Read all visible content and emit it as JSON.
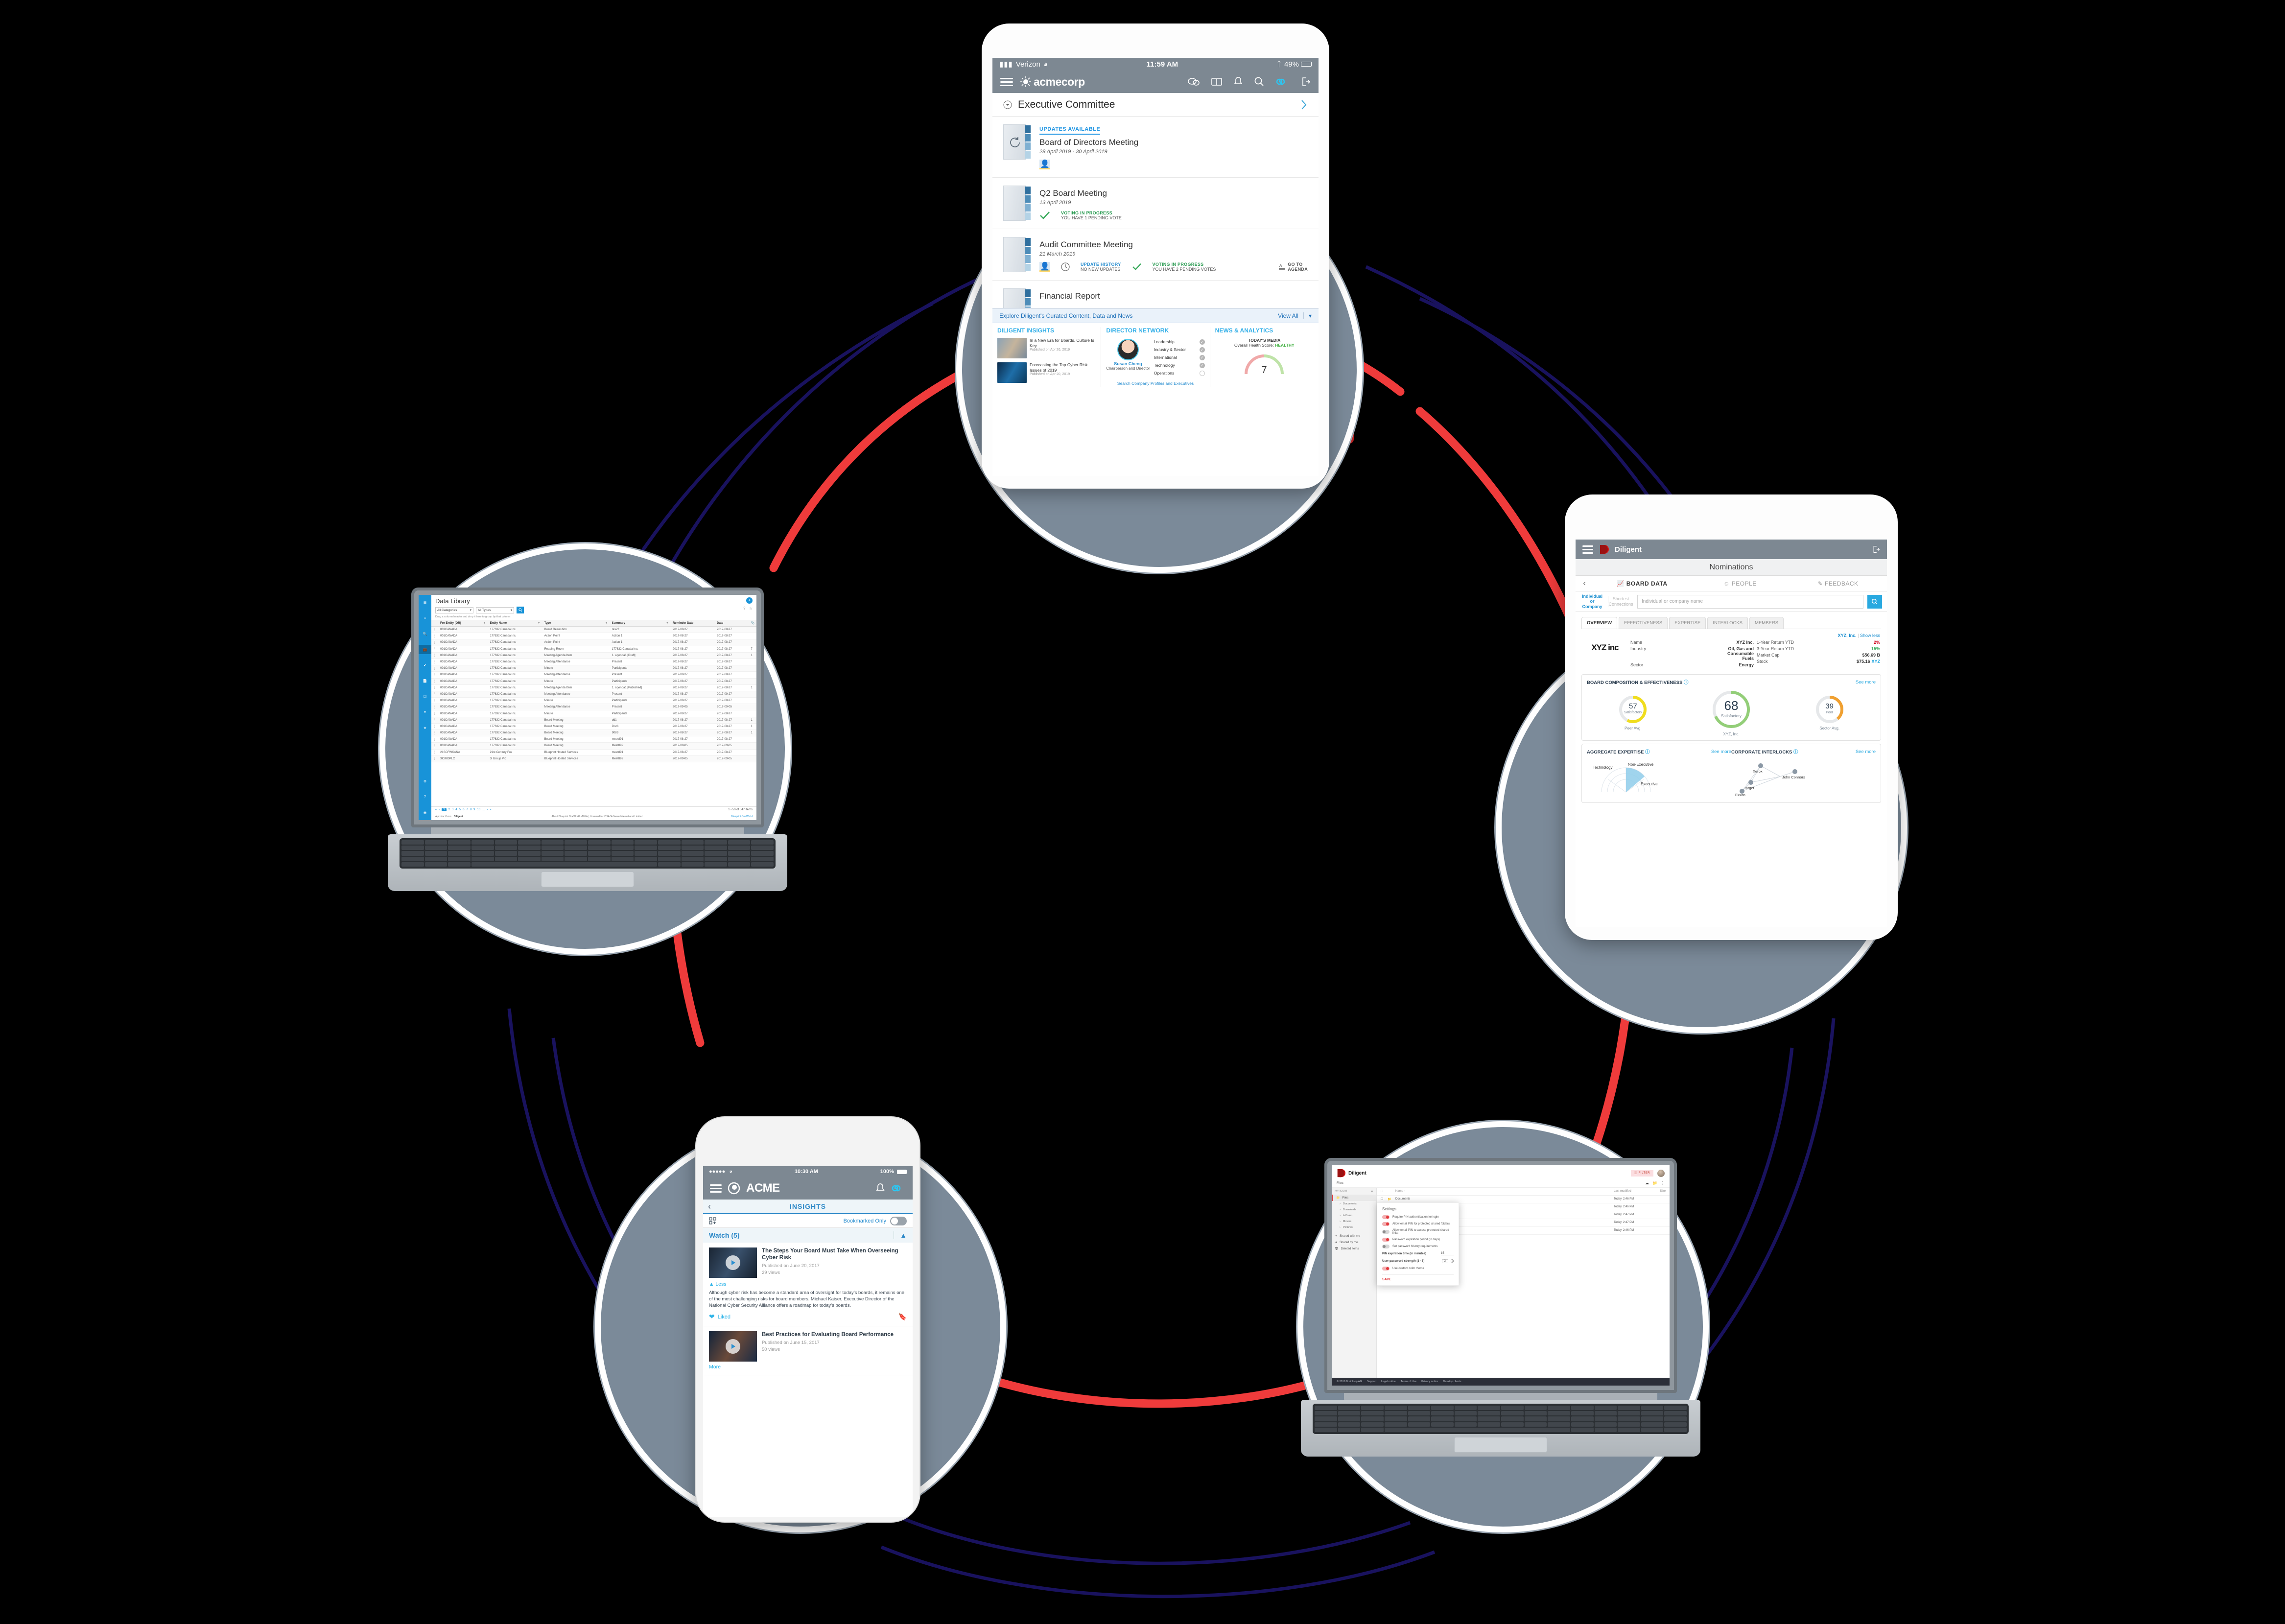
{
  "scene": {
    "background": "#000000",
    "ring_color": "#ef3b3b",
    "arc_color": "#1b1464",
    "plate_color": "#7b8a99",
    "lock_icon": "padlock-icon"
  },
  "tablet_acme": {
    "status": {
      "carrier": "Verizon",
      "wifi": "wifi-icon",
      "time": "11:59 AM",
      "bluetooth": "bluetooth-icon",
      "battery": "49%"
    },
    "nav": {
      "menu": "hamburger-icon",
      "brand": "acmecorp",
      "icons": [
        "chat-icon",
        "book-icon",
        "bell-icon",
        "search-icon",
        "infinity-icon",
        "logout-icon"
      ]
    },
    "section": {
      "label": "Executive Committee",
      "chevron": "chevron-right-icon"
    },
    "items": [
      {
        "badge": "UPDATES AVAILABLE",
        "title": "Board of Directors Meeting",
        "date": "28 April 2019 - 30 April 2019",
        "meta": [
          {
            "icon": "people-icon",
            "line1": "",
            "line2": ""
          }
        ]
      },
      {
        "badge": "",
        "title": "Q2 Board Meeting",
        "date": "13 April 2019",
        "meta": [
          {
            "icon": "check-icon",
            "line1": "VOTING IN PROGRESS",
            "line2": "YOU HAVE 1 PENDING VOTE"
          }
        ]
      },
      {
        "badge": "",
        "title": "Audit Committee Meeting",
        "date": "21 March 2019",
        "meta": [
          {
            "icon": "people-icon",
            "line1": "",
            "line2": ""
          },
          {
            "icon": "clock-icon",
            "line1": "UPDATE HISTORY",
            "line2": "NO NEW UPDATES"
          },
          {
            "icon": "check-icon",
            "line1": "VOTING IN PROGRESS",
            "line2": "YOU HAVE 2 PENDING VOTES"
          },
          {
            "icon": "agenda-icon",
            "line1": "GO TO",
            "line2": "AGENDA"
          }
        ]
      },
      {
        "badge": "",
        "title": "Financial Report",
        "date": "",
        "meta": []
      }
    ],
    "explore": {
      "label": "Explore Diligent's Curated Content, Data and News",
      "view_all": "View All",
      "chevron": "chevron-down-icon"
    },
    "insights": {
      "heading": "DILIGENT INSIGHTS",
      "articles": [
        {
          "title": "In a New Era for Boards, Culture Is Key",
          "published": "Published on Apr 26, 2019"
        },
        {
          "title": "Forecasting the Top Cyber Risk Issues of 2019",
          "published": "Published on Apr 20, 2019"
        }
      ]
    },
    "director_network": {
      "heading": "DIRECTOR NETWORK",
      "person": {
        "name": "Susan Cheng",
        "role": "Chairperson and Director"
      },
      "skills": [
        {
          "label": "Leadership",
          "checked": true
        },
        {
          "label": "Industry & Sector",
          "checked": true
        },
        {
          "label": "International",
          "checked": true
        },
        {
          "label": "Technology",
          "checked": true
        },
        {
          "label": "Operations",
          "checked": false
        }
      ],
      "link": "Search Company Profiles and Executives"
    },
    "news_analytics": {
      "heading": "NEWS & ANALYTICS",
      "subheading": "TODAY'S MEDIA",
      "score_label": "Overall Health Score:",
      "score_value": "HEALTHY",
      "gauge_number": "7"
    }
  },
  "tablet_diligent": {
    "nav": {
      "menu": "hamburger-icon",
      "brand": "Diligent",
      "logout": "logout-icon"
    },
    "page_title": "Nominations",
    "back": "chevron-left-icon",
    "tabs": [
      {
        "label": "BOARD DATA",
        "icon": "chart-icon",
        "active": true
      },
      {
        "label": "PEOPLE",
        "icon": "person-icon",
        "active": false
      },
      {
        "label": "FEEDBACK",
        "icon": "feedback-icon",
        "active": false
      }
    ],
    "search": {
      "segments": [
        {
          "label": "Individual or Company",
          "active": true
        },
        {
          "label": "Shortest Connections",
          "active": false
        }
      ],
      "placeholder": "Individual or company name",
      "button": "search-icon"
    },
    "subtabs": [
      {
        "label": "OVERVIEW",
        "active": true
      },
      {
        "label": "EFFECTIVENESS",
        "active": false
      },
      {
        "label": "EXPERTISE",
        "active": false
      },
      {
        "label": "INTERLOCKS",
        "active": false
      },
      {
        "label": "MEMBERS",
        "active": false
      }
    ],
    "company": {
      "chip": "XYZ, Inc.",
      "show_less": "Show less",
      "logo_text": "XYZ inc",
      "facts_left": [
        {
          "label": "Name",
          "value": "XYZ Inc."
        },
        {
          "label": "Industry",
          "value": "Oil, Gas and Consumable Fuels"
        },
        {
          "label": "Sector",
          "value": "Energy"
        }
      ],
      "facts_right": [
        {
          "label": "1-Year Return YTD",
          "value": "2%",
          "trend": "down"
        },
        {
          "label": "3-Year Return YTD",
          "value": "15%",
          "trend": "up"
        },
        {
          "label": "Market Cap",
          "value": "$56.69 B",
          "trend": ""
        },
        {
          "label": "Stock",
          "value": "$75.16",
          "ticker": "XYZ",
          "trend": ""
        }
      ]
    },
    "composition": {
      "heading": "BOARD COMPOSITION & EFFECTIVENESS",
      "info": "info-icon",
      "see_more": "See more",
      "center_caption": "XYZ, Inc.",
      "gauges": [
        {
          "value": "57",
          "rating": "Satisfactory",
          "caption": "Peer Avg.",
          "color": "#f0dd1e",
          "pct": 57
        },
        {
          "value": "68",
          "rating": "Satisfactory",
          "caption": "",
          "color": "#93ce78",
          "pct": 68
        },
        {
          "value": "39",
          "rating": "Poor",
          "caption": "Sector Avg.",
          "color": "#f0a030",
          "pct": 39
        }
      ]
    },
    "expertise": {
      "heading": "AGGREGATE EXPERTISE",
      "info": "info-icon",
      "see_more": "See more",
      "labels": [
        "Technology",
        "Non-Executive",
        "Executive"
      ]
    },
    "interlocks": {
      "heading": "CORPORATE INTERLOCKS",
      "info": "info-icon",
      "see_more": "See more",
      "nodes": [
        "Xerox",
        "John Connors",
        "Target",
        "Exxon"
      ]
    }
  },
  "phone_acme": {
    "status": {
      "signal": "signal-dots-icon",
      "wifi": "wifi-icon",
      "time": "10:30 AM",
      "battery": "100%"
    },
    "nav": {
      "menu": "hamburger-icon",
      "brand": "ACME",
      "bell": "bell-icon",
      "infinity": "infinity-icon"
    },
    "subnav": {
      "back": "chevron-left-icon",
      "title": "INSIGHTS"
    },
    "filter": {
      "grid_icon": "add-grid-icon",
      "toggle_label": "Bookmarked Only",
      "toggle_on": false
    },
    "section": {
      "label": "Watch (5)",
      "chevron": "chevron-up-icon"
    },
    "cards": [
      {
        "title": "The Steps Your Board Must Take When Overseeing Cyber Risk",
        "published": "Published on June 20, 2017",
        "views": "29 views",
        "expand": "Less",
        "body": "Although cyber risk has become a standard area of oversight for today’s boards, it remains one of the most challenging risks for board members. Michael Kaiser, Executive Director of the National Cyber Security Alliance offers a roadmap for today’s boards.",
        "like": "Liked",
        "bookmark": "bookmark-icon"
      },
      {
        "title": "Best Practices for Evaluating Board Performance",
        "published": "Published on June 15, 2017",
        "views": "50 views",
        "expand": "More",
        "body": "",
        "like": "",
        "bookmark": ""
      }
    ]
  },
  "laptop_datalibrary": {
    "sidebar_icons": [
      "hamburger-icon",
      "home-icon",
      "search-icon",
      "briefcase-icon",
      "check-icon",
      "document-icon",
      "tasks-icon",
      "clock-icon",
      "star-icon",
      "gear-icon",
      "help-icon",
      "user-icon"
    ],
    "title": "Data Library",
    "filters": [
      {
        "label": "All Categories"
      },
      {
        "label": "All Types"
      }
    ],
    "search_button": "search-icon",
    "actions": [
      "add-icon",
      "share-icon",
      "star-icon"
    ],
    "group_hint": "Drag a column header and drop it here to group by that column",
    "columns": [
      "For Entity (OR)",
      "Entity Name",
      "Type",
      "Summary",
      "Reminder Date",
      "Date",
      "attachment-icon"
    ],
    "rows": [
      [
        "001CANADA",
        "177632 Canada Inc.",
        "Board Resolution",
        "res22",
        "2017-08-27",
        "2017-08-27",
        ""
      ],
      [
        "001CANADA",
        "177632 Canada Inc.",
        "Action Point",
        "Action 1",
        "2017-08-27",
        "2017-08-27",
        ""
      ],
      [
        "001CANADA",
        "177632 Canada Inc.",
        "Action Point",
        "Action 1",
        "2017-08-27",
        "2017-08-27",
        ""
      ],
      [
        "001CANADA",
        "177632 Canada Inc.",
        "Reading Room",
        "177632 Canada Inc.",
        "2017-08-27",
        "2017-08-27",
        "7"
      ],
      [
        "001CANADA",
        "177632 Canada Inc.",
        "Meeting Agenda Item",
        "1. agenda1 [Draft]",
        "2017-08-27",
        "2017-08-27",
        "1"
      ],
      [
        "001CANADA",
        "177632 Canada Inc.",
        "Meeting Attendance",
        "Present",
        "2017-08-27",
        "2017-08-27",
        ""
      ],
      [
        "001CANADA",
        "177632 Canada Inc.",
        "Minute",
        "Participants",
        "2017-08-27",
        "2017-08-27",
        ""
      ],
      [
        "001CANADA",
        "177632 Canada Inc.",
        "Meeting Attendance",
        "Present",
        "2017-08-27",
        "2017-08-27",
        ""
      ],
      [
        "001CANADA",
        "177632 Canada Inc.",
        "Minute",
        "Participants",
        "2017-08-27",
        "2017-08-27",
        ""
      ],
      [
        "001CANADA",
        "177632 Canada Inc.",
        "Meeting Agenda Item",
        "1. agenda1 [Published]",
        "2017-08-27",
        "2017-08-27",
        "1"
      ],
      [
        "001CANADA",
        "177632 Canada Inc.",
        "Meeting Attendance",
        "Present",
        "2017-08-27",
        "2017-09-27",
        ""
      ],
      [
        "001CANADA",
        "177632 Canada Inc.",
        "Minute",
        "Participants",
        "2017-08-27",
        "2017-08-27",
        ""
      ],
      [
        "001CANADA",
        "177632 Canada Inc.",
        "Meeting Attendance",
        "Present",
        "2017-09-05",
        "2017-09-05",
        ""
      ],
      [
        "001CANADA",
        "177632 Canada Inc.",
        "Minute",
        "Participants",
        "2017-08-27",
        "2017-08-27",
        ""
      ],
      [
        "001CANADA",
        "177632 Canada Inc.",
        "Board Meeting",
        "dd1",
        "2017-08-27",
        "2017-08-27",
        "1"
      ],
      [
        "001CANADA",
        "177632 Canada Inc.",
        "Board Meeting",
        "Doc1",
        "2017-08-27",
        "2017-08-27",
        "1"
      ],
      [
        "001CANADA",
        "177632 Canada Inc.",
        "Board Meeting",
        "9089",
        "2017-08-27",
        "2017-08-27",
        "1"
      ],
      [
        "001CANADA",
        "177632 Canada Inc.",
        "Board Meeting",
        "meet891",
        "2017-08-27",
        "2017-08-27",
        ""
      ],
      [
        "001CANADA",
        "177632 Canada Inc.",
        "Board Meeting",
        "Meet892",
        "2017-09-05",
        "2017-09-05",
        ""
      ],
      [
        "21SCFWKANA",
        "21st Century Fox",
        "Blueprint Hosted Services",
        "meet891",
        "2017-08-27",
        "2017-08-27",
        ""
      ],
      [
        "3IGROPLC",
        "3i Group Plc",
        "Blueprint Hosted Services",
        "Meet892",
        "2017-09-05",
        "2017-09-05",
        ""
      ]
    ],
    "pagination": {
      "pages": [
        "1",
        "2",
        "3",
        "4",
        "5",
        "6",
        "7",
        "8",
        "9",
        "10",
        "..."
      ],
      "current": "1",
      "items": "1 - 50 of 547 items"
    },
    "footer": {
      "left": "A product from",
      "brand": "Diligent",
      "center": "About Blueprint OneWorld v10.6a   |   Licensed to: ICSA Software International Limited",
      "right": "Blueprint OneWorld"
    }
  },
  "laptop_brainloop": {
    "brand": "Diligent",
    "filter_button": "FILTER",
    "filter_icon": "filter-icon",
    "avatar": "avatar",
    "breadcrumb": "Files",
    "toolbar_icons": [
      "upload-icon",
      "new-folder-icon",
      "more-vertical-icon"
    ],
    "sidebar": {
      "heading": "MYROOM",
      "collapse": "chevron-up-icon",
      "items": [
        {
          "label": "Files",
          "icon": "folder-icon",
          "selected": true
        },
        {
          "label": "Documents",
          "icon": "chevron-right-icon",
          "sub": true
        },
        {
          "label": "Downloads",
          "icon": "chevron-right-icon",
          "sub": true
        },
        {
          "label": "InVision",
          "icon": "chevron-right-icon",
          "sub": true
        },
        {
          "label": "Movies",
          "icon": "chevron-right-icon",
          "sub": true
        },
        {
          "label": "Pictures",
          "icon": "chevron-right-icon",
          "sub": true
        },
        {
          "label": "Shared with me",
          "icon": "share-in-icon",
          "selected": false
        },
        {
          "label": "Shared by me",
          "icon": "share-out-icon",
          "selected": false
        },
        {
          "label": "Deleted items",
          "icon": "trash-icon",
          "selected": false
        }
      ]
    },
    "file_columns": [
      "",
      "",
      "Name",
      "Last modified",
      "Size"
    ],
    "sort_icon": "arrow-up-icon",
    "files": [
      {
        "name": "Documents",
        "modified": "Today, 2:46 PM",
        "size": ""
      },
      {
        "name": "Downloads",
        "modified": "Today, 2:46 PM",
        "size": ""
      },
      {
        "name": "InVision",
        "modified": "Today, 2:47 PM",
        "size": ""
      },
      {
        "name": "Movies",
        "modified": "Today, 2:47 PM",
        "size": ""
      },
      {
        "name": "Pictures",
        "modified": "Today, 2:46 PM",
        "size": ""
      }
    ],
    "settings": {
      "title": "Settings",
      "toggles": [
        {
          "label": "Require PIN authentication for login",
          "on": true
        },
        {
          "label": "Allow email PIN for protected shared folders",
          "on": true
        },
        {
          "label": "Allow email PIN to access protected shared links",
          "on": false
        },
        {
          "label": "Password expiration period (in days)",
          "on": true
        },
        {
          "label": "Set password history requirements",
          "on": false
        }
      ],
      "fields": [
        {
          "label": "PIN expiration time (in minutes)",
          "value": "15"
        },
        {
          "label": "User password strength (3 - 5)",
          "value": "3",
          "info": "info-icon"
        }
      ],
      "theme_toggle": {
        "label": "Use custom color theme",
        "on": true
      },
      "save": "SAVE"
    },
    "footer": {
      "copyright": "© 2019 Brainloop AG",
      "links": [
        "Support",
        "Legal notice",
        "Terms of Use",
        "Privacy notice",
        "Desktop clients"
      ]
    }
  }
}
